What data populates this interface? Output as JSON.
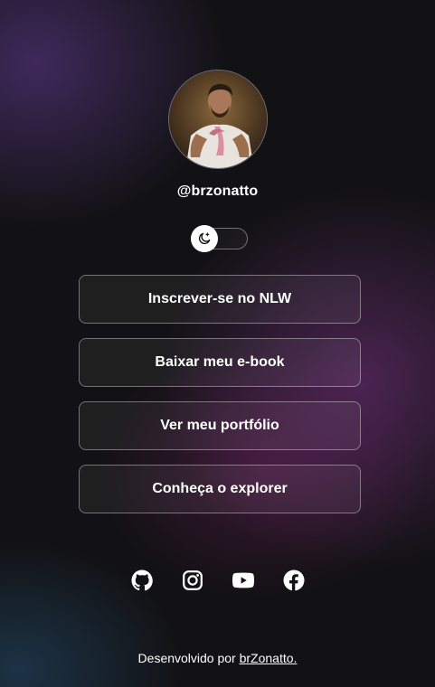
{
  "profile": {
    "username": "@brzonatto",
    "avatar_icon": "profile-photo"
  },
  "theme_switch": {
    "icon": "moon-icon",
    "state": "dark"
  },
  "links": [
    {
      "label": "Inscrever-se no NLW"
    },
    {
      "label": "Baixar meu e-book"
    },
    {
      "label": "Ver meu portfólio"
    },
    {
      "label": "Conheça o explorer"
    }
  ],
  "social": [
    {
      "icon": "github-icon"
    },
    {
      "icon": "instagram-icon"
    },
    {
      "icon": "youtube-icon"
    },
    {
      "icon": "facebook-icon"
    }
  ],
  "footer": {
    "text": "Desenvolvido por ",
    "link_label": "brZonatto."
  },
  "colors": {
    "background": "#121214",
    "text": "#ffffff",
    "accent_purple": "#7a3a8e"
  }
}
